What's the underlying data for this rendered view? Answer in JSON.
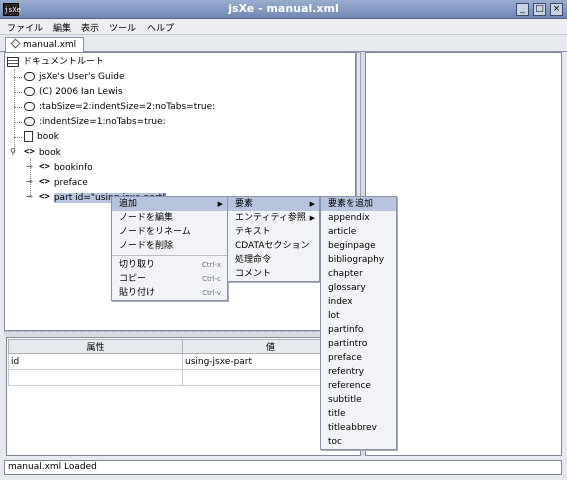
{
  "window": {
    "title": "jsXe - manual.xml",
    "app_icon_text": "jsXe",
    "buttons": [
      "_",
      "□",
      "×"
    ]
  },
  "menubar": [
    "ファイル",
    "編集",
    "表示",
    "ツール",
    "ヘルプ"
  ],
  "tab": {
    "label": "manual.xml",
    "icon": "diamond-icon"
  },
  "tree": {
    "root": "ドキュメントルート",
    "nodes": [
      "jsXe's User's Guide",
      "(C) 2006 Ian Lewis",
      ":tabSize=2:indentSize=2:noTabs=true:",
      ":indentSize=1:noTabs=true:",
      "book",
      "book",
      "bookinfo",
      "preface",
      "part id=\"using-jsxe-part\""
    ]
  },
  "attributes": {
    "headers": [
      "属性",
      "値"
    ],
    "rows": [
      [
        "id",
        "using-jsxe-part"
      ],
      [
        "",
        ""
      ]
    ]
  },
  "status": "manual.xml Loaded",
  "context_menu": {
    "items": [
      {
        "label": "追加",
        "highlighted": true,
        "submenu": true
      },
      {
        "label": "ノードを編集"
      },
      {
        "label": "ノードをリネーム"
      },
      {
        "label": "ノードを削除"
      }
    ],
    "clip_items": [
      {
        "label": "切り取り",
        "shortcut": "Ctrl-x"
      },
      {
        "label": "コピー",
        "shortcut": "Ctrl-c"
      },
      {
        "label": "貼り付け",
        "shortcut": "Ctrl-v"
      }
    ]
  },
  "add_submenu": [
    {
      "label": "要素",
      "highlighted": true,
      "submenu": true
    },
    {
      "label": "エンティティ参照",
      "submenu": true
    },
    {
      "label": "テキスト"
    },
    {
      "label": "CDATAセクション"
    },
    {
      "label": "処理命令"
    },
    {
      "label": "コメント"
    }
  ],
  "element_submenu": [
    "要素を追加",
    "appendix",
    "article",
    "beginpage",
    "bibliography",
    "chapter",
    "glossary",
    "index",
    "lot",
    "partinfo",
    "partintro",
    "preface",
    "refentry",
    "reference",
    "subtitle",
    "title",
    "titleabbrev",
    "toc"
  ]
}
